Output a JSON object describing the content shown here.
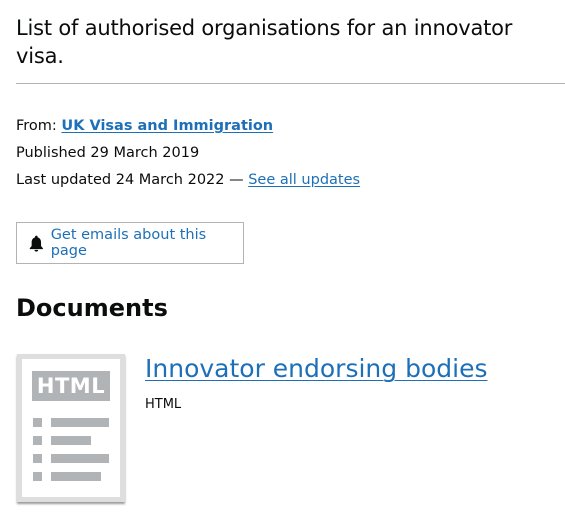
{
  "header": {
    "description": "List of authorised organisations for an innovator visa."
  },
  "metadata": {
    "from_label": "From:",
    "from_org": "UK Visas and Immigration",
    "published_label": "Published",
    "published_date": "29 March 2019",
    "updated_label": "Last updated",
    "updated_date": "24 March 2022",
    "separator": "—",
    "see_all_updates": "See all updates"
  },
  "subscribe": {
    "label": "Get emails about this page",
    "icon": "bell-icon"
  },
  "documents": {
    "heading": "Documents",
    "items": [
      {
        "title": "Innovator endorsing bodies",
        "format": "HTML",
        "thumbnail_label": "HTML"
      }
    ]
  },
  "colors": {
    "link": "#1d70b8",
    "text": "#0b0c0c",
    "border": "#b1b4b6"
  }
}
